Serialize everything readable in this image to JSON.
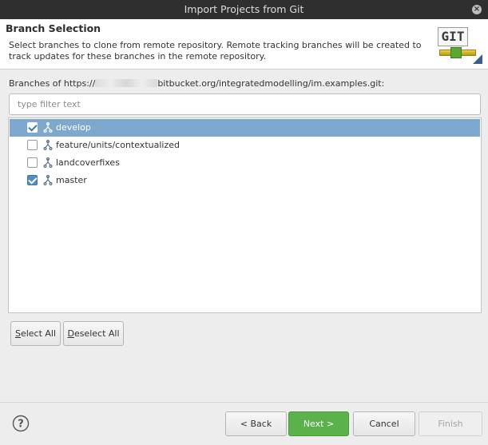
{
  "window": {
    "title": "Import Projects from Git"
  },
  "header": {
    "title": "Branch Selection",
    "description": "Select branches to clone from remote repository. Remote tracking branches will be created to track updates for these branches in the remote repository.",
    "logo_text": "GIT"
  },
  "branches": {
    "label_prefix": "Branches of https://",
    "label_suffix": "bitbucket.org/integratedmodelling/im.examples.git:",
    "filter_placeholder": "type filter text",
    "items": [
      {
        "label": "develop",
        "checked": true,
        "selected": true
      },
      {
        "label": "feature/units/contextualized",
        "checked": false,
        "selected": false
      },
      {
        "label": "landcoverfixes",
        "checked": false,
        "selected": false
      },
      {
        "label": "master",
        "checked": true,
        "selected": false
      }
    ]
  },
  "selection_buttons": {
    "select_all_mnemonic": "S",
    "select_all_rest": "elect All",
    "deselect_all_mnemonic": "D",
    "deselect_all_rest": "eselect All"
  },
  "footer": {
    "back_label": "< Back",
    "next_label": "Next >",
    "cancel_label": "Cancel",
    "finish_label": "Finish"
  },
  "colors": {
    "accent_green": "#5bb24b",
    "selection_blue": "#7ea9cf",
    "checkbox_blue": "#4f8ec4"
  }
}
